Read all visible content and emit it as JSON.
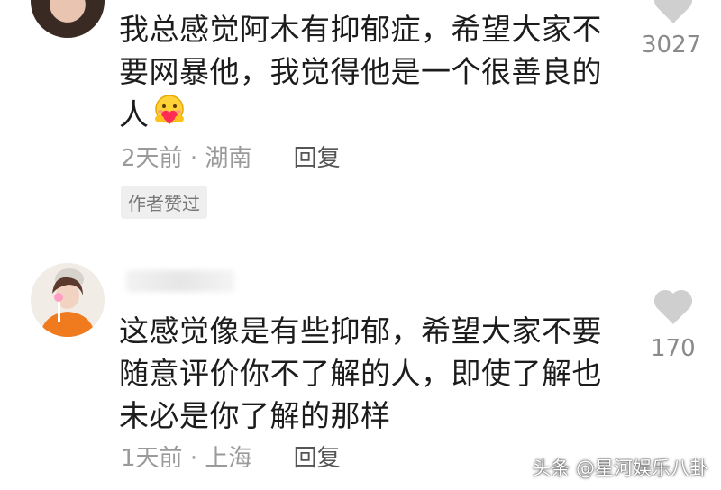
{
  "comments": [
    {
      "text_line1": "我总感觉阿木有抑郁症，希望大家不",
      "text_line2": "要网暴他，我觉得他是一个很善良的",
      "text_line3": "人",
      "emoji": "hug-heart-emoji",
      "time": "2天前",
      "separator": "·",
      "location": "湖南",
      "reply_label": "回复",
      "badge": "作者赞过",
      "likes": "3027"
    },
    {
      "text_line1": "这感觉像是有些抑郁，希望大家不要",
      "text_line2": "随意评价你不了解的人，即使了解也",
      "text_line3": "未必是你了解的那样",
      "time": "1天前",
      "separator": "·",
      "location": "上海",
      "reply_label": "回复",
      "likes": "170"
    }
  ],
  "watermark": "头条 @星河娱乐八卦",
  "colors": {
    "like_icon": "#cfcfcf",
    "meta_text": "#9a9a9a",
    "badge_bg": "#efefef"
  }
}
